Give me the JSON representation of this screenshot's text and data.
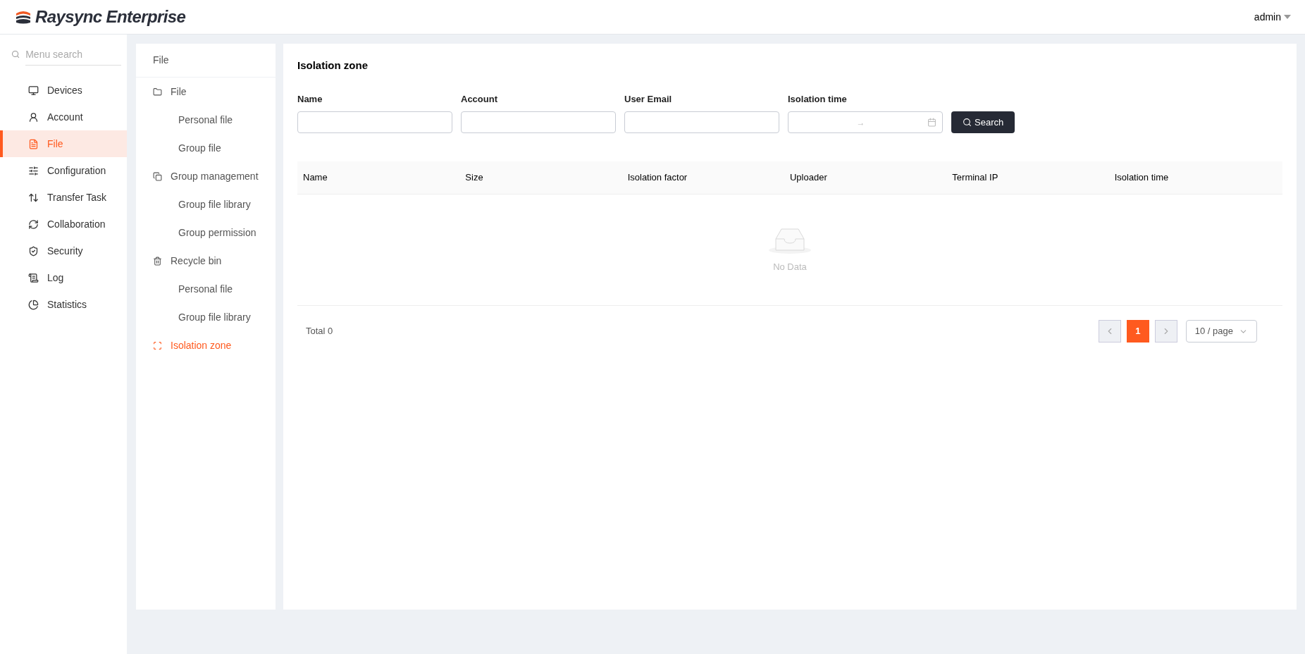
{
  "header": {
    "logo_text": "Raysync Enterprise",
    "user": "admin"
  },
  "sidebar": {
    "search": {
      "placeholder": "Menu search"
    },
    "items": [
      {
        "label": "Devices",
        "selected": false
      },
      {
        "label": "Account",
        "selected": false
      },
      {
        "label": "File",
        "selected": true
      },
      {
        "label": "Configuration",
        "selected": false
      },
      {
        "label": "Transfer Task",
        "selected": false
      },
      {
        "label": "Collaboration",
        "selected": false
      },
      {
        "label": "Security",
        "selected": false
      },
      {
        "label": "Log",
        "selected": false
      },
      {
        "label": "Statistics",
        "selected": false
      }
    ]
  },
  "submenu": {
    "title": "File",
    "items": [
      {
        "label": "File",
        "selected": false,
        "children": [
          {
            "label": "Personal file",
            "selected": false
          },
          {
            "label": "Group file",
            "selected": false
          }
        ]
      },
      {
        "label": "Group management",
        "selected": false,
        "children": [
          {
            "label": "Group file library",
            "selected": false
          },
          {
            "label": "Group permission",
            "selected": false
          }
        ]
      },
      {
        "label": "Recycle bin",
        "selected": false,
        "children": [
          {
            "label": "Personal file",
            "selected": false
          },
          {
            "label": "Group file library",
            "selected": false
          }
        ]
      },
      {
        "label": "Isolation zone",
        "selected": true
      }
    ]
  },
  "main": {
    "title": "Isolation zone",
    "filters": [
      {
        "label": "Name",
        "kind": "text"
      },
      {
        "label": "Account",
        "kind": "text"
      },
      {
        "label": "User Email",
        "kind": "text"
      },
      {
        "label": "Isolation time",
        "kind": "daterange",
        "separator": "→"
      }
    ],
    "search_button": "Search",
    "table": {
      "columns": [
        "Name",
        "Size",
        "Isolation factor",
        "Uploader",
        "Terminal IP",
        "Isolation time"
      ],
      "empty_text": "No Data"
    },
    "pagination": {
      "total": "Total 0",
      "pages": [
        {
          "label": "1",
          "selected": true
        }
      ],
      "page_size": "10 / page"
    }
  }
}
